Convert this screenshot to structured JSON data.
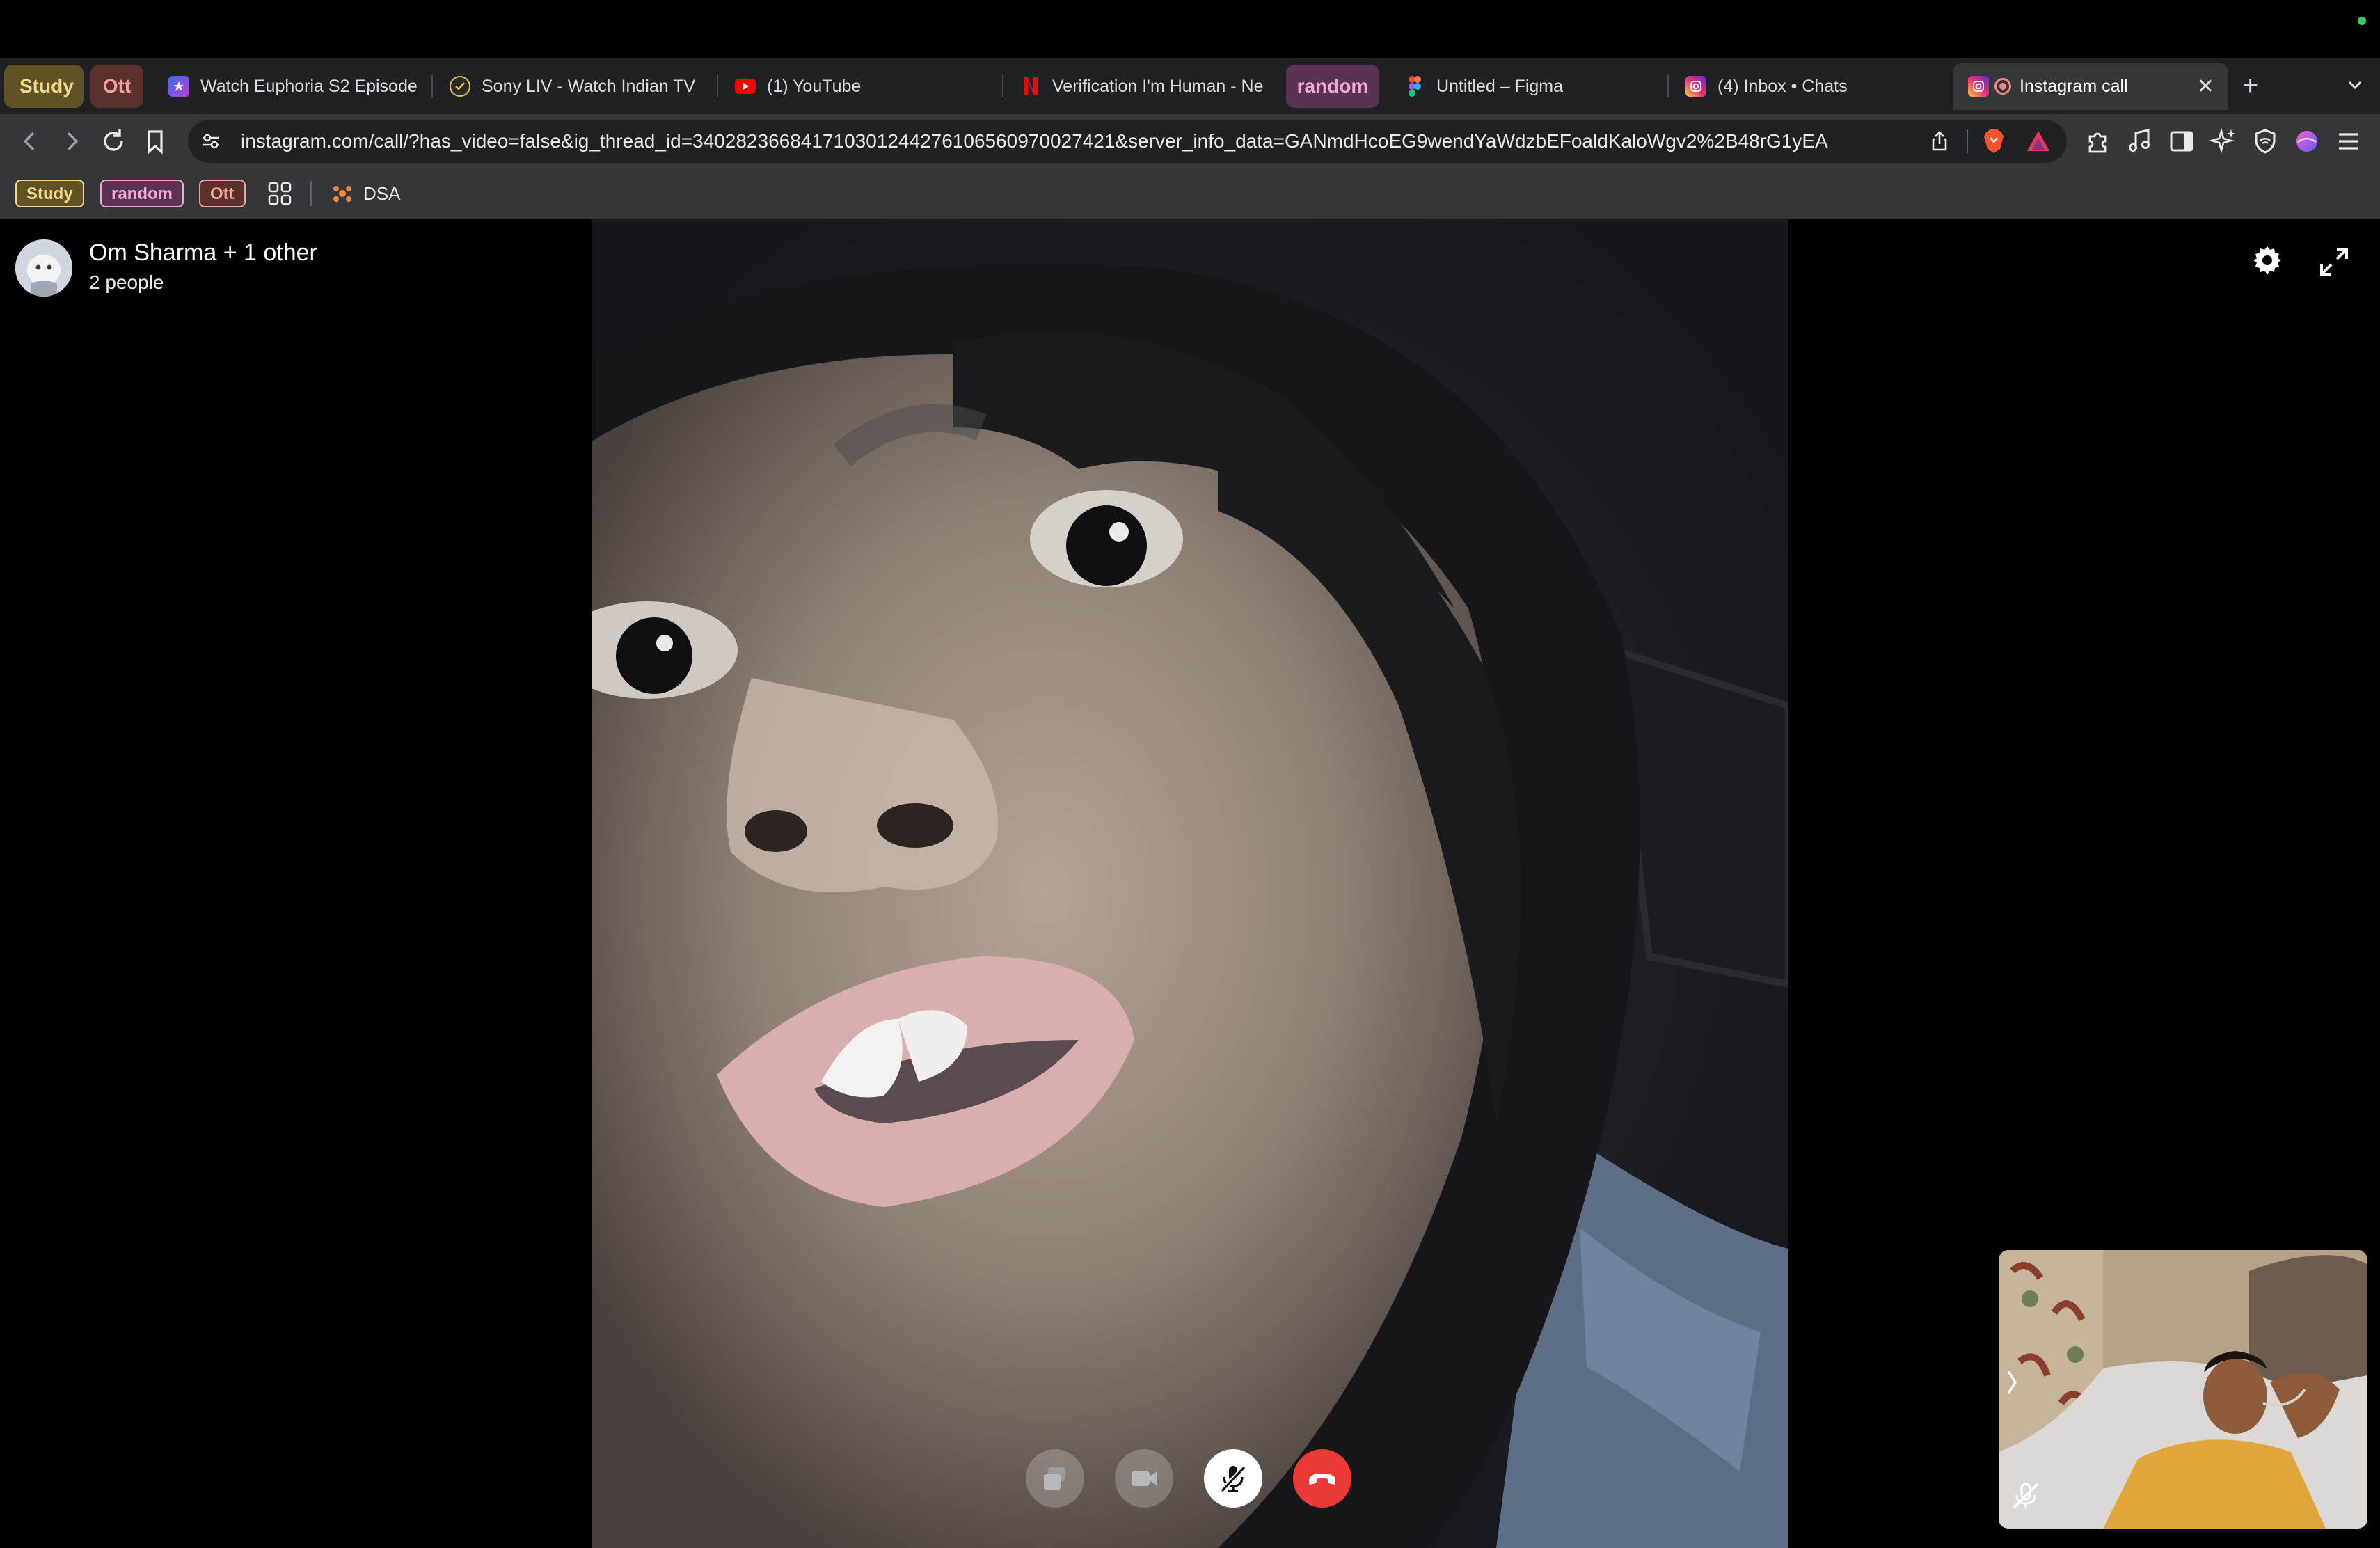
{
  "tab_groups": [
    "Study",
    "Ott",
    "random"
  ],
  "tabs": [
    {
      "label": "Watch Euphoria S2 Episode"
    },
    {
      "label": "Sony LIV - Watch Indian TV"
    },
    {
      "label": "(1) YouTube"
    },
    {
      "label": "Verification I'm Human - Ne"
    },
    {
      "label": "Untitled – Figma"
    },
    {
      "label": "(4) Inbox • Chats"
    },
    {
      "label": "Instagram call"
    }
  ],
  "address_bar": {
    "url": "instagram.com/call/?has_video=false&ig_thread_id=340282366841710301244276106560970027421&server_info_data=GANmdHcoEG9wendYaWdzbEFoaldKaloWgv2%2B48rG1yEA"
  },
  "bookmarks_bar": {
    "chips": [
      "Study",
      "random",
      "Ott"
    ],
    "folder": "DSA"
  },
  "call": {
    "title": "Om Sharma + 1 other",
    "participants": "2 people"
  },
  "colors": {
    "study_group": "#f4d78a",
    "ott_group": "#f2a49b",
    "random_group": "#f3a7d8",
    "end_call": "#ea3a35"
  },
  "icons": {
    "back": "arrow-left-icon",
    "forward": "arrow-right-icon",
    "reload": "reload-icon",
    "bookmark": "bookmark-icon",
    "settings": "gear-icon",
    "fullscreen": "expand-icon",
    "screen_share": "screen-share-icon",
    "camera": "video-camera-icon",
    "mic_muted": "mic-off-icon",
    "hang_up": "phone-hangup-icon"
  }
}
